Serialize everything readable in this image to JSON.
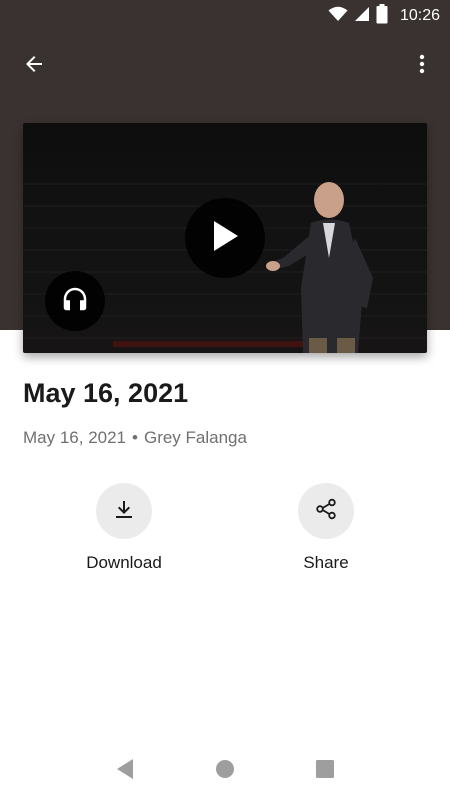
{
  "status_bar": {
    "time": "10:26",
    "icons": [
      "wifi-icon",
      "cell-signal-icon",
      "battery-icon"
    ]
  },
  "app_bar": {
    "back_icon": "arrow-back-icon",
    "menu_icon": "more-vertical-icon"
  },
  "video": {
    "play_icon": "play-icon",
    "audio_icon": "headphones-icon"
  },
  "sermon": {
    "title": "May 16, 2021",
    "date": "May 16, 2021",
    "separator": "•",
    "speaker": "Grey Falanga"
  },
  "actions": {
    "download_label": "Download",
    "share_label": "Share"
  },
  "nav_bar": {
    "icons": [
      "nav-back-icon",
      "nav-home-icon",
      "nav-recents-icon"
    ]
  },
  "colors": {
    "header_background": "#3a3230",
    "action_circle": "#ebebeb",
    "meta_text": "#707070"
  }
}
